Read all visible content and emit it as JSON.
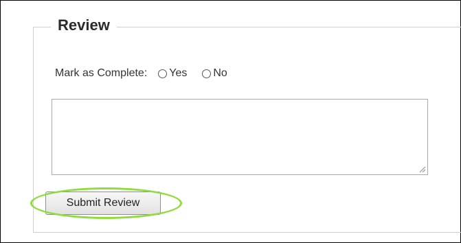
{
  "review": {
    "legend": "Review",
    "complete_label": "Mark as Complete:",
    "options": [
      {
        "label": "Yes"
      },
      {
        "label": "No"
      }
    ],
    "comment_value": "",
    "submit_label": "Submit Review"
  },
  "annotation": {
    "color": "#8fdc3c"
  }
}
